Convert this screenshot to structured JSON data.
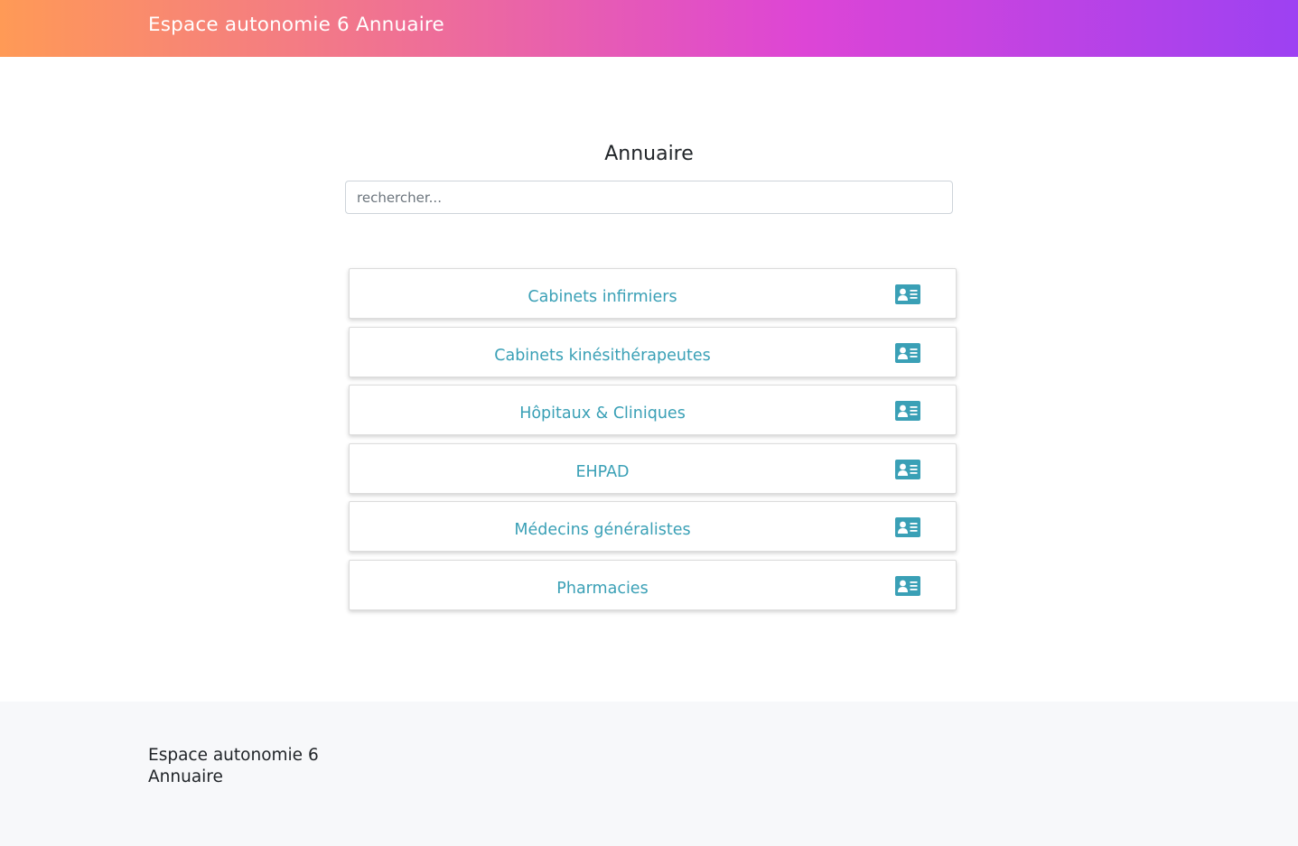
{
  "header": {
    "brand": "Espace autonomie 6 Annuaire"
  },
  "main": {
    "title": "Annuaire",
    "search": {
      "placeholder": "rechercher...",
      "value": ""
    },
    "categories": [
      {
        "label": "Cabinets infirmiers",
        "icon": "address-card-icon"
      },
      {
        "label": "Cabinets kinésithérapeutes",
        "icon": "address-card-icon"
      },
      {
        "label": "Hôpitaux & Cliniques",
        "icon": "address-card-icon"
      },
      {
        "label": "EHPAD",
        "icon": "address-card-icon"
      },
      {
        "label": "Médecins généralistes",
        "icon": "address-card-icon"
      },
      {
        "label": "Pharmacies",
        "icon": "address-card-icon"
      }
    ]
  },
  "footer": {
    "line1": "Espace autonomie 6",
    "line2": "Annuaire"
  },
  "colors": {
    "accent": "#3aa0b6",
    "gradient_start": "#ff9a56",
    "gradient_mid": "#dd45d6",
    "gradient_end": "#9d41f2",
    "footer_bg": "#f7f8fa"
  }
}
